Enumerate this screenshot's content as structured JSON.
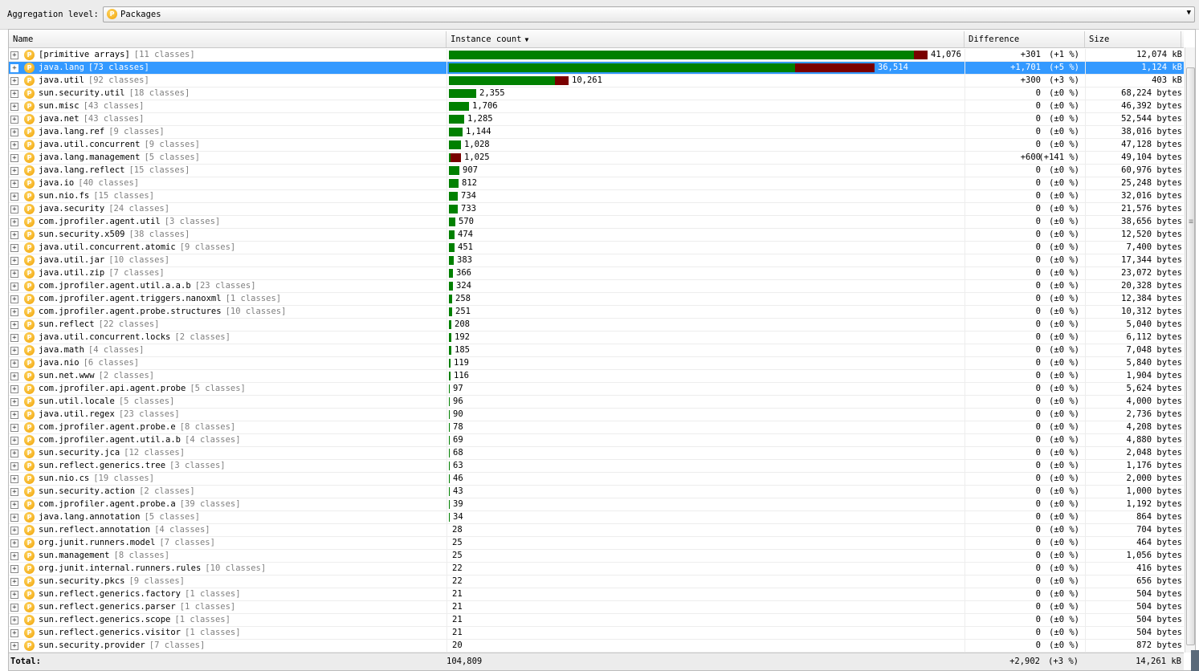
{
  "toolbar": {
    "aggregation_label": "Aggregation level:",
    "aggregation_value": "Packages",
    "pkg_icon_letter": "P"
  },
  "columns": {
    "name": "Name",
    "instance_count": "Instance count",
    "difference": "Difference",
    "size": "Size"
  },
  "colors": {
    "bar_green": "#008000",
    "bar_red": "#7a0000",
    "selection": "#3399ff",
    "package_icon": "#f0a000"
  },
  "max_instance_count": 41076,
  "selected_row_index": 1,
  "rows": [
    {
      "name": "[primitive arrays]",
      "classes": "[11 classes]",
      "count": 41076,
      "count_label": "41,076",
      "diff": "+301",
      "diff_pct": "(+1 %)",
      "size": "12,074 kB",
      "added": 301
    },
    {
      "name": "java.lang",
      "classes": "[73 classes]",
      "count": 36514,
      "count_label": "36,514",
      "diff": "+1,701",
      "diff_pct": "(+5 %)",
      "size": "1,124 kB",
      "added": 1701
    },
    {
      "name": "java.util",
      "classes": "[92 classes]",
      "count": 10261,
      "count_label": "10,261",
      "diff": "+300",
      "diff_pct": "(+3 %)",
      "size": "403 kB",
      "added": 300
    },
    {
      "name": "sun.security.util",
      "classes": "[18 classes]",
      "count": 2355,
      "count_label": "2,355",
      "diff": "0",
      "diff_pct": "(±0 %)",
      "size": "68,224 bytes",
      "added": 0
    },
    {
      "name": "sun.misc",
      "classes": "[43 classes]",
      "count": 1706,
      "count_label": "1,706",
      "diff": "0",
      "diff_pct": "(±0 %)",
      "size": "46,392 bytes",
      "added": 0
    },
    {
      "name": "java.net",
      "classes": "[43 classes]",
      "count": 1285,
      "count_label": "1,285",
      "diff": "0",
      "diff_pct": "(±0 %)",
      "size": "52,544 bytes",
      "added": 0
    },
    {
      "name": "java.lang.ref",
      "classes": "[9 classes]",
      "count": 1144,
      "count_label": "1,144",
      "diff": "0",
      "diff_pct": "(±0 %)",
      "size": "38,016 bytes",
      "added": 0
    },
    {
      "name": "java.util.concurrent",
      "classes": "[9 classes]",
      "count": 1028,
      "count_label": "1,028",
      "diff": "0",
      "diff_pct": "(±0 %)",
      "size": "47,128 bytes",
      "added": 0
    },
    {
      "name": "java.lang.management",
      "classes": "[5 classes]",
      "count": 1025,
      "count_label": "1,025",
      "diff": "+600",
      "diff_pct": "(+141 %)",
      "size": "49,104 bytes",
      "added": 600
    },
    {
      "name": "java.lang.reflect",
      "classes": "[15 classes]",
      "count": 907,
      "count_label": "907",
      "diff": "0",
      "diff_pct": "(±0 %)",
      "size": "60,976 bytes",
      "added": 0
    },
    {
      "name": "java.io",
      "classes": "[40 classes]",
      "count": 812,
      "count_label": "812",
      "diff": "0",
      "diff_pct": "(±0 %)",
      "size": "25,248 bytes",
      "added": 0
    },
    {
      "name": "sun.nio.fs",
      "classes": "[15 classes]",
      "count": 734,
      "count_label": "734",
      "diff": "0",
      "diff_pct": "(±0 %)",
      "size": "32,016 bytes",
      "added": 0
    },
    {
      "name": "java.security",
      "classes": "[24 classes]",
      "count": 733,
      "count_label": "733",
      "diff": "0",
      "diff_pct": "(±0 %)",
      "size": "21,576 bytes",
      "added": 0
    },
    {
      "name": "com.jprofiler.agent.util",
      "classes": "[3 classes]",
      "count": 570,
      "count_label": "570",
      "diff": "0",
      "diff_pct": "(±0 %)",
      "size": "38,656 bytes",
      "added": 0
    },
    {
      "name": "sun.security.x509",
      "classes": "[38 classes]",
      "count": 474,
      "count_label": "474",
      "diff": "0",
      "diff_pct": "(±0 %)",
      "size": "12,520 bytes",
      "added": 0
    },
    {
      "name": "java.util.concurrent.atomic",
      "classes": "[9 classes]",
      "count": 451,
      "count_label": "451",
      "diff": "0",
      "diff_pct": "(±0 %)",
      "size": "7,400 bytes",
      "added": 0
    },
    {
      "name": "java.util.jar",
      "classes": "[10 classes]",
      "count": 383,
      "count_label": "383",
      "diff": "0",
      "diff_pct": "(±0 %)",
      "size": "17,344 bytes",
      "added": 0
    },
    {
      "name": "java.util.zip",
      "classes": "[7 classes]",
      "count": 366,
      "count_label": "366",
      "diff": "0",
      "diff_pct": "(±0 %)",
      "size": "23,072 bytes",
      "added": 0
    },
    {
      "name": "com.jprofiler.agent.util.a.a.b",
      "classes": "[23 classes]",
      "count": 324,
      "count_label": "324",
      "diff": "0",
      "diff_pct": "(±0 %)",
      "size": "20,328 bytes",
      "added": 0
    },
    {
      "name": "com.jprofiler.agent.triggers.nanoxml",
      "classes": "[1 classes]",
      "count": 258,
      "count_label": "258",
      "diff": "0",
      "diff_pct": "(±0 %)",
      "size": "12,384 bytes",
      "added": 0
    },
    {
      "name": "com.jprofiler.agent.probe.structures",
      "classes": "[10 classes]",
      "count": 251,
      "count_label": "251",
      "diff": "0",
      "diff_pct": "(±0 %)",
      "size": "10,312 bytes",
      "added": 0
    },
    {
      "name": "sun.reflect",
      "classes": "[22 classes]",
      "count": 208,
      "count_label": "208",
      "diff": "0",
      "diff_pct": "(±0 %)",
      "size": "5,040 bytes",
      "added": 0
    },
    {
      "name": "java.util.concurrent.locks",
      "classes": "[2 classes]",
      "count": 192,
      "count_label": "192",
      "diff": "0",
      "diff_pct": "(±0 %)",
      "size": "6,112 bytes",
      "added": 0
    },
    {
      "name": "java.math",
      "classes": "[4 classes]",
      "count": 185,
      "count_label": "185",
      "diff": "0",
      "diff_pct": "(±0 %)",
      "size": "7,048 bytes",
      "added": 0
    },
    {
      "name": "java.nio",
      "classes": "[6 classes]",
      "count": 119,
      "count_label": "119",
      "diff": "0",
      "diff_pct": "(±0 %)",
      "size": "5,840 bytes",
      "added": 0
    },
    {
      "name": "sun.net.www",
      "classes": "[2 classes]",
      "count": 116,
      "count_label": "116",
      "diff": "0",
      "diff_pct": "(±0 %)",
      "size": "1,904 bytes",
      "added": 0
    },
    {
      "name": "com.jprofiler.api.agent.probe",
      "classes": "[5 classes]",
      "count": 97,
      "count_label": "97",
      "diff": "0",
      "diff_pct": "(±0 %)",
      "size": "5,624 bytes",
      "added": 0
    },
    {
      "name": "sun.util.locale",
      "classes": "[5 classes]",
      "count": 96,
      "count_label": "96",
      "diff": "0",
      "diff_pct": "(±0 %)",
      "size": "4,000 bytes",
      "added": 0
    },
    {
      "name": "java.util.regex",
      "classes": "[23 classes]",
      "count": 90,
      "count_label": "90",
      "diff": "0",
      "diff_pct": "(±0 %)",
      "size": "2,736 bytes",
      "added": 0
    },
    {
      "name": "com.jprofiler.agent.probe.e",
      "classes": "[8 classes]",
      "count": 78,
      "count_label": "78",
      "diff": "0",
      "diff_pct": "(±0 %)",
      "size": "4,208 bytes",
      "added": 0
    },
    {
      "name": "com.jprofiler.agent.util.a.b",
      "classes": "[4 classes]",
      "count": 69,
      "count_label": "69",
      "diff": "0",
      "diff_pct": "(±0 %)",
      "size": "4,880 bytes",
      "added": 0
    },
    {
      "name": "sun.security.jca",
      "classes": "[12 classes]",
      "count": 68,
      "count_label": "68",
      "diff": "0",
      "diff_pct": "(±0 %)",
      "size": "2,048 bytes",
      "added": 0
    },
    {
      "name": "sun.reflect.generics.tree",
      "classes": "[3 classes]",
      "count": 63,
      "count_label": "63",
      "diff": "0",
      "diff_pct": "(±0 %)",
      "size": "1,176 bytes",
      "added": 0
    },
    {
      "name": "sun.nio.cs",
      "classes": "[19 classes]",
      "count": 46,
      "count_label": "46",
      "diff": "0",
      "diff_pct": "(±0 %)",
      "size": "2,000 bytes",
      "added": 0
    },
    {
      "name": "sun.security.action",
      "classes": "[2 classes]",
      "count": 43,
      "count_label": "43",
      "diff": "0",
      "diff_pct": "(±0 %)",
      "size": "1,000 bytes",
      "added": 0
    },
    {
      "name": "com.jprofiler.agent.probe.a",
      "classes": "[39 classes]",
      "count": 39,
      "count_label": "39",
      "diff": "0",
      "diff_pct": "(±0 %)",
      "size": "1,192 bytes",
      "added": 0
    },
    {
      "name": "java.lang.annotation",
      "classes": "[5 classes]",
      "count": 34,
      "count_label": "34",
      "diff": "0",
      "diff_pct": "(±0 %)",
      "size": "864 bytes",
      "added": 0
    },
    {
      "name": "sun.reflect.annotation",
      "classes": "[4 classes]",
      "count": 28,
      "count_label": "28",
      "diff": "0",
      "diff_pct": "(±0 %)",
      "size": "704 bytes",
      "added": 0
    },
    {
      "name": "org.junit.runners.model",
      "classes": "[7 classes]",
      "count": 25,
      "count_label": "25",
      "diff": "0",
      "diff_pct": "(±0 %)",
      "size": "464 bytes",
      "added": 0
    },
    {
      "name": "sun.management",
      "classes": "[8 classes]",
      "count": 25,
      "count_label": "25",
      "diff": "0",
      "diff_pct": "(±0 %)",
      "size": "1,056 bytes",
      "added": 0
    },
    {
      "name": "org.junit.internal.runners.rules",
      "classes": "[10 classes]",
      "count": 22,
      "count_label": "22",
      "diff": "0",
      "diff_pct": "(±0 %)",
      "size": "416 bytes",
      "added": 0
    },
    {
      "name": "sun.security.pkcs",
      "classes": "[9 classes]",
      "count": 22,
      "count_label": "22",
      "diff": "0",
      "diff_pct": "(±0 %)",
      "size": "656 bytes",
      "added": 0
    },
    {
      "name": "sun.reflect.generics.factory",
      "classes": "[1 classes]",
      "count": 21,
      "count_label": "21",
      "diff": "0",
      "diff_pct": "(±0 %)",
      "size": "504 bytes",
      "added": 0
    },
    {
      "name": "sun.reflect.generics.parser",
      "classes": "[1 classes]",
      "count": 21,
      "count_label": "21",
      "diff": "0",
      "diff_pct": "(±0 %)",
      "size": "504 bytes",
      "added": 0
    },
    {
      "name": "sun.reflect.generics.scope",
      "classes": "[1 classes]",
      "count": 21,
      "count_label": "21",
      "diff": "0",
      "diff_pct": "(±0 %)",
      "size": "504 bytes",
      "added": 0
    },
    {
      "name": "sun.reflect.generics.visitor",
      "classes": "[1 classes]",
      "count": 21,
      "count_label": "21",
      "diff": "0",
      "diff_pct": "(±0 %)",
      "size": "504 bytes",
      "added": 0
    },
    {
      "name": "sun.security.provider",
      "classes": "[7 classes]",
      "count": 20,
      "count_label": "20",
      "diff": "0",
      "diff_pct": "(±0 %)",
      "size": "872 bytes",
      "added": 0
    }
  ],
  "total": {
    "label": "Total:",
    "instance_count": "104,809",
    "difference": "+2,902",
    "difference_pct": "(+3 %)",
    "size": "14,261 kB"
  }
}
